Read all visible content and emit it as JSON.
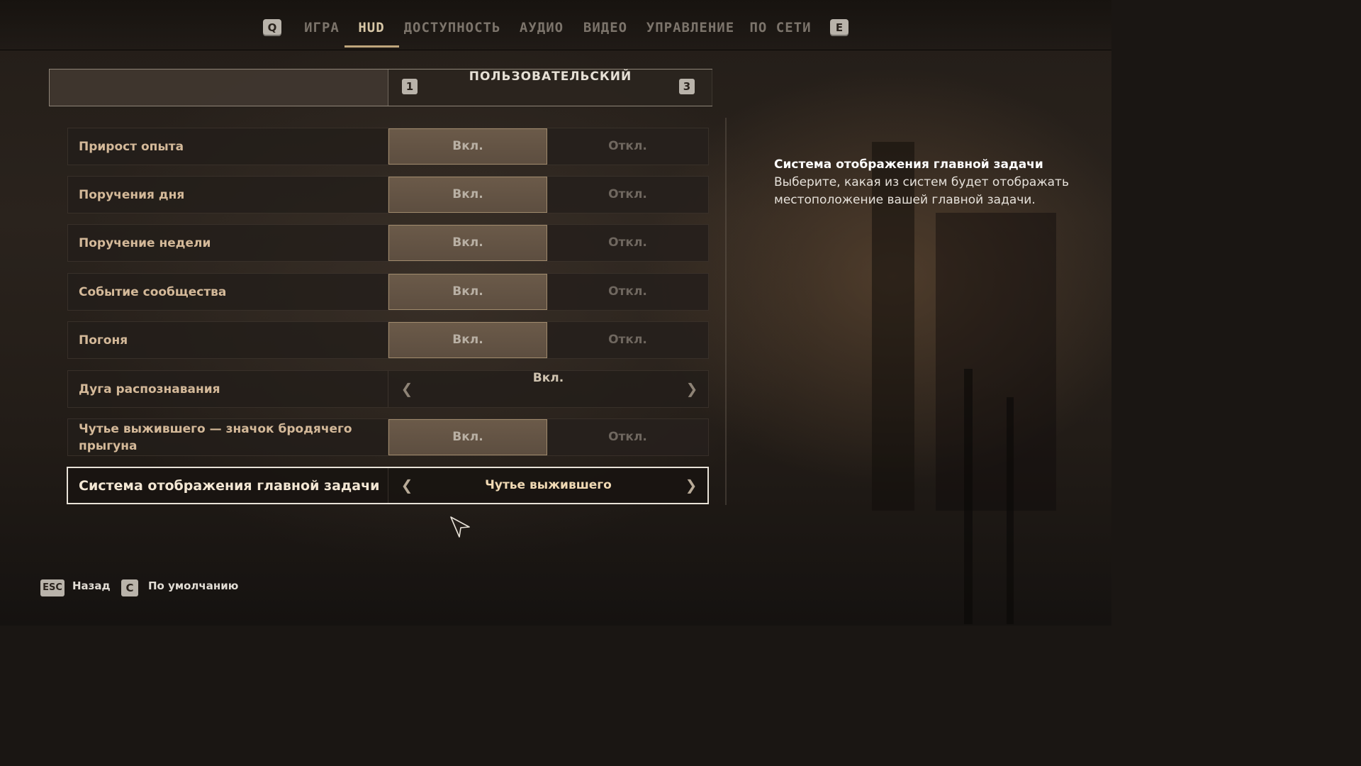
{
  "nav": {
    "left_key": "Q",
    "right_key": "E",
    "tabs": [
      {
        "label": "ИГРА"
      },
      {
        "label": "HUD"
      },
      {
        "label": "ДОСТУПНОСТЬ"
      },
      {
        "label": "АУДИО"
      },
      {
        "label": "ВИДЕО"
      },
      {
        "label": "УПРАВЛЕНИЕ"
      },
      {
        "label": "ПО СЕТИ"
      }
    ],
    "active_tab": "HUD"
  },
  "preset": {
    "prev_key": "1",
    "next_key": "3",
    "value": "ПОЛЬЗОВАТЕЛЬСКИЙ"
  },
  "settings": [
    {
      "label": "Прирост опыта",
      "type": "toggle",
      "on_label": "Вкл.",
      "off_label": "Откл.",
      "value": "on"
    },
    {
      "label": "Поручения дня",
      "type": "toggle",
      "on_label": "Вкл.",
      "off_label": "Откл.",
      "value": "on"
    },
    {
      "label": "Поручение недели",
      "type": "toggle",
      "on_label": "Вкл.",
      "off_label": "Откл.",
      "value": "on"
    },
    {
      "label": "Событие сообщества",
      "type": "toggle",
      "on_label": "Вкл.",
      "off_label": "Откл.",
      "value": "on"
    },
    {
      "label": "Погоня",
      "type": "toggle",
      "on_label": "Вкл.",
      "off_label": "Откл.",
      "value": "on"
    },
    {
      "label": "Дуга распознавания",
      "type": "selector",
      "value": "Вкл."
    },
    {
      "label": "Чутье выжившего — значок бродячего прыгуна",
      "type": "toggle",
      "on_label": "Вкл.",
      "off_label": "Откл.",
      "value": "on"
    },
    {
      "label": "Система отображения главной задачи",
      "type": "selector",
      "value": "Чутье выжившего",
      "selected": true
    }
  ],
  "description": {
    "title": "Система отображения главной задачи",
    "text": "Выберите, какая из систем будет отображать местоположение вашей главной задачи."
  },
  "footer": {
    "back_key": "ESC",
    "back_label": "Назад",
    "default_key": "C",
    "default_label": "По умолчанию"
  },
  "colors": {
    "accent": "#bfa67c",
    "label": "#d4b999",
    "toggle_on_bg": "#5d4e40"
  }
}
